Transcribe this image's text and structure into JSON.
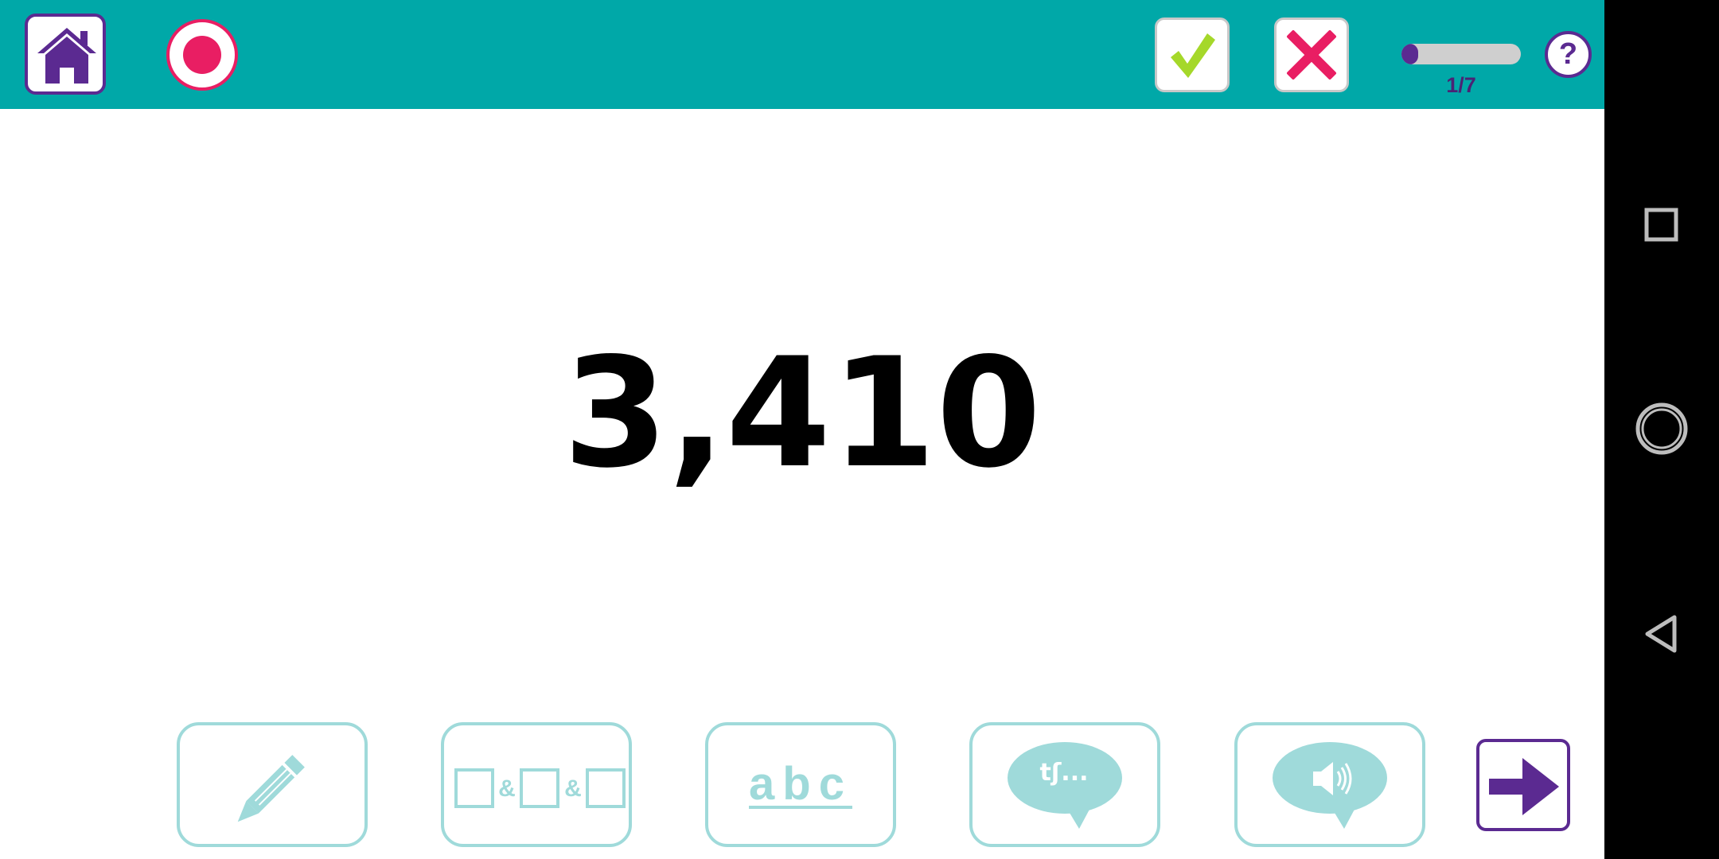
{
  "toolbar": {
    "home_icon": "home-icon",
    "record_icon": "record-icon",
    "correct_icon": "checkmark-icon",
    "incorrect_icon": "cross-icon",
    "help_label": "?",
    "progress": {
      "current": 1,
      "total": 7,
      "label": "1/7",
      "fraction": 0.143
    }
  },
  "main": {
    "number": "3,410"
  },
  "tools": [
    {
      "name": "pencil",
      "icon": "pencil-icon"
    },
    {
      "name": "blocks",
      "icon": "boxes-and-ampersands-icon",
      "label_parts": [
        "&",
        "&"
      ]
    },
    {
      "name": "spelling",
      "icon": "abc-icon",
      "label": "abc"
    },
    {
      "name": "phonics",
      "icon": "speech-bubble-icon",
      "label": "tʃ..."
    },
    {
      "name": "listen",
      "icon": "speaker-bubble-icon"
    }
  ],
  "next_icon": "arrow-right-icon",
  "colors": {
    "topbar": "#00a8a8",
    "purple": "#5b2a91",
    "pink": "#e91e63",
    "check_green": "#a5d82a",
    "tool_teal": "#9fdada"
  },
  "system_nav": {
    "square_icon": "recents-icon",
    "circle_icon": "home-circle-icon",
    "triangle_icon": "back-icon"
  }
}
